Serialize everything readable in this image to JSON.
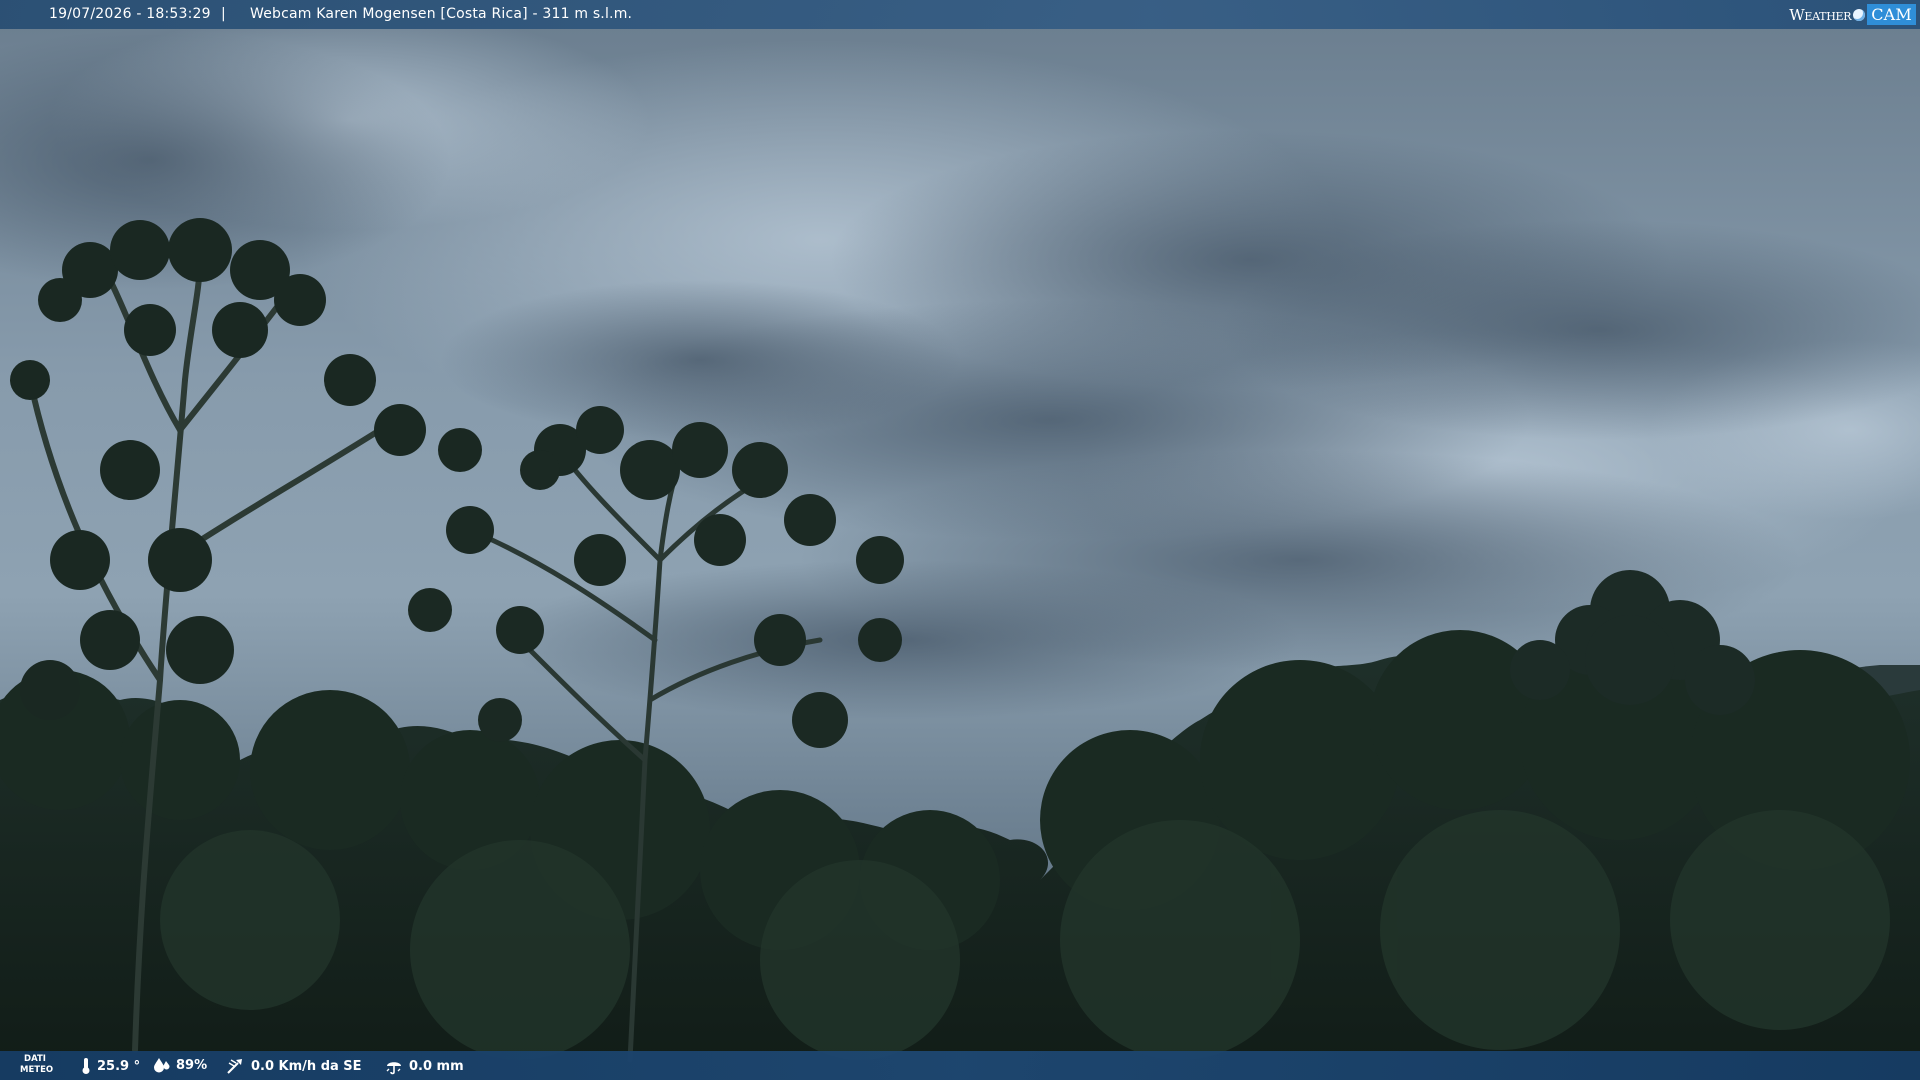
{
  "overlay": {
    "timestamp": "19/07/2026 - 18:53:29",
    "separator": "|",
    "title": "Webcam Karen Mogensen [Costa Rica] - 311 m s.l.m.",
    "logo_left": "Weather",
    "logo_right": "CAM"
  },
  "weather": {
    "label_line1": "DATI",
    "label_line2": "METEO",
    "temperature": "25.9 °",
    "humidity": "89%",
    "wind": "0.0 Km/h da SE",
    "rain": "0.0 mm"
  },
  "icons": {
    "temperature": "thermometer-icon",
    "humidity": "humidity-drop-icon",
    "wind": "wind-icon",
    "rain": "rain-icon"
  },
  "colors": {
    "sky_top": "#6c7f90",
    "sky_mid": "#8fa3b4",
    "sky_low": "#7e92a3",
    "forest": "#17261f",
    "bar": "#2c5a86"
  }
}
